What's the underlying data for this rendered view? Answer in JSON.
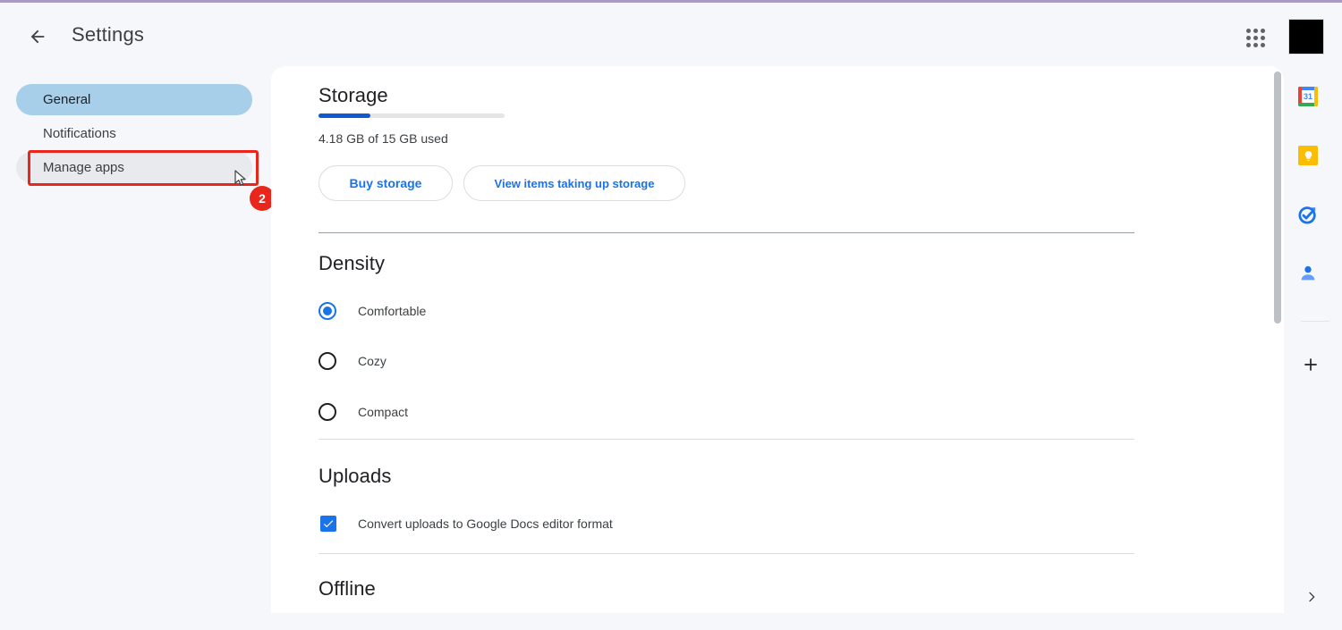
{
  "header": {
    "back_icon": "arrow-left-icon",
    "title": "Settings",
    "apps_launcher_icon": "apps-grid-icon",
    "avatar_label": "account-avatar"
  },
  "sidebar": {
    "items": [
      {
        "label": "General",
        "state": "selected"
      },
      {
        "label": "Notifications",
        "state": "default"
      },
      {
        "label": "Manage apps",
        "state": "hover"
      }
    ]
  },
  "annotation": {
    "badge_number": "2",
    "highlight_target": "Manage apps",
    "box_color": "#e8261b",
    "cursor_icon": "mouse-pointer-icon"
  },
  "main": {
    "storage": {
      "title": "Storage",
      "progress_percent": 28,
      "usage_text": "4.18 GB of 15 GB used",
      "buttons": [
        {
          "label": "Buy storage"
        },
        {
          "label": "View items taking up storage"
        }
      ]
    },
    "density": {
      "title": "Density",
      "selected": "Comfortable",
      "options": [
        {
          "label": "Comfortable",
          "checked": true
        },
        {
          "label": "Cozy",
          "checked": false
        },
        {
          "label": "Compact",
          "checked": false
        }
      ]
    },
    "uploads": {
      "title": "Uploads",
      "checkbox_label": "Convert uploads to Google Docs editor format",
      "checked": true
    },
    "offline": {
      "title": "Offline"
    }
  },
  "right_rail": {
    "items": [
      {
        "name": "google-calendar-icon",
        "day": "31"
      },
      {
        "name": "google-keep-icon"
      },
      {
        "name": "google-tasks-icon"
      },
      {
        "name": "google-contacts-icon"
      }
    ],
    "add_button_icon": "plus-icon",
    "expand_button_icon": "chevron-right-icon"
  },
  "colors": {
    "accent_blue": "#1a73e8",
    "progress_blue": "#1158d3",
    "selected_pill": "#a8cfe9",
    "hover_pill": "#e8eaed",
    "page_background": "#f6f7fb",
    "card_background": "#ffffff",
    "annotation_red": "#e8261b",
    "top_rule": "#a79ac4"
  }
}
